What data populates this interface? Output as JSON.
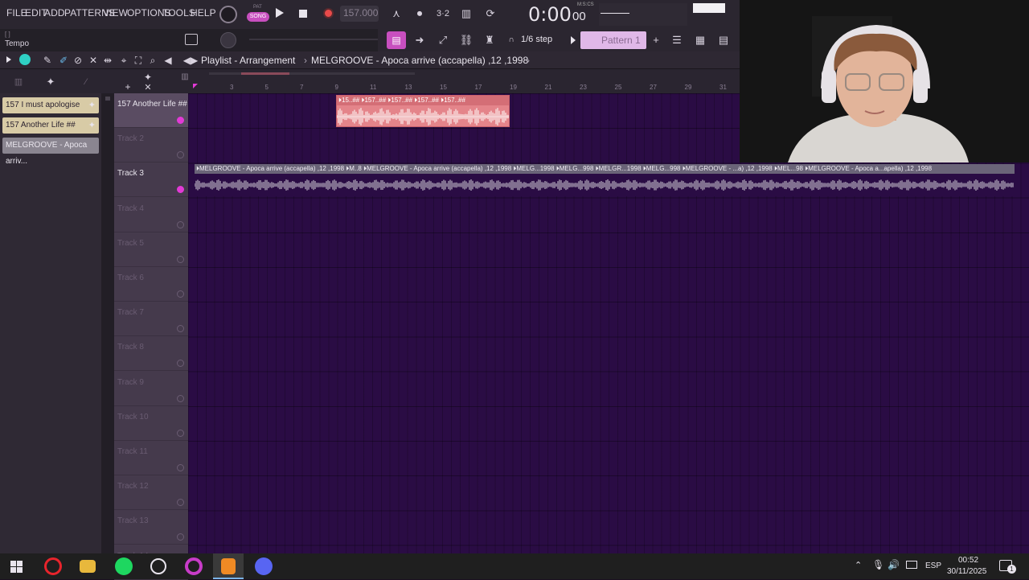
{
  "menu": {
    "file": "FILE",
    "edit": "EDIT",
    "add": "ADD",
    "patterns": "PATTERNS",
    "view": "VIEW",
    "options": "OPTIONS",
    "tools": "TOOLS",
    "help": "HELP"
  },
  "transport": {
    "pat_label": "PAT",
    "song_label": "SONG",
    "tempo": "157.000",
    "time": "0:00",
    "time_small": "00",
    "time_format": "M:S:CS"
  },
  "hint_bar": {
    "bracket": "[ ]",
    "label": "Tempo"
  },
  "toolbar2": {
    "step": "1/6 step",
    "pattern": "Pattern 1"
  },
  "playlist": {
    "title": "Playlist - Arrangement",
    "breadcrumb": "MELGROOVE - Apoca arrive (accapella) ,12 ,1998"
  },
  "picker": [
    {
      "label": "157 I must apologise",
      "color": "#d8cba6"
    },
    {
      "label": "157 Another Life ##",
      "color": "#d8cba6"
    },
    {
      "label": "MELGROOVE - Apoca arriv...",
      "color": "#8a8590"
    }
  ],
  "ruler_ticks": [
    "3",
    "5",
    "7",
    "9",
    "11",
    "13",
    "15",
    "17",
    "19",
    "21",
    "23",
    "25",
    "27",
    "29",
    "31"
  ],
  "tracks": [
    {
      "name": "157 Another Life ##"
    },
    {
      "name": "Track 2"
    },
    {
      "name": "Track 3"
    },
    {
      "name": "Track 4"
    },
    {
      "name": "Track 5"
    },
    {
      "name": "Track 6"
    },
    {
      "name": "Track 7"
    },
    {
      "name": "Track 8"
    },
    {
      "name": "Track 9"
    },
    {
      "name": "Track 10"
    },
    {
      "name": "Track 11"
    },
    {
      "name": "Track 12"
    },
    {
      "name": "Track 13"
    },
    {
      "name": "Track 14"
    }
  ],
  "clips": {
    "track1_head": "⏵15..## ⏵157..## ⏵157..## ⏵157..## ⏵157..##",
    "track3_head": "⏵MELGROOVE - Apoca arrive (accapella) ,12 ,1998 ⏵M..8 ⏵MELGROOVE - Apoca arrive (accapella) ,12 ,1998 ⏵MELG...1998 ⏵MELG...998 ⏵MELGR...1998 ⏵MELG...998 ⏵MELGROOVE - ...a) ,12 ,1998 ⏵MEL...98 ⏵MELGROOVE - Apoca a...apella) ,12 ,1998"
  },
  "taskbar": {
    "lang": "ESP",
    "time": "00:52",
    "date": "30/11/2025",
    "notif": "1"
  },
  "colors": {
    "grid_bg": "#2a0c44",
    "clip_red": "#e4848a",
    "clip_gray": "#a8a4b0",
    "accent_pink": "#e23ad6"
  }
}
